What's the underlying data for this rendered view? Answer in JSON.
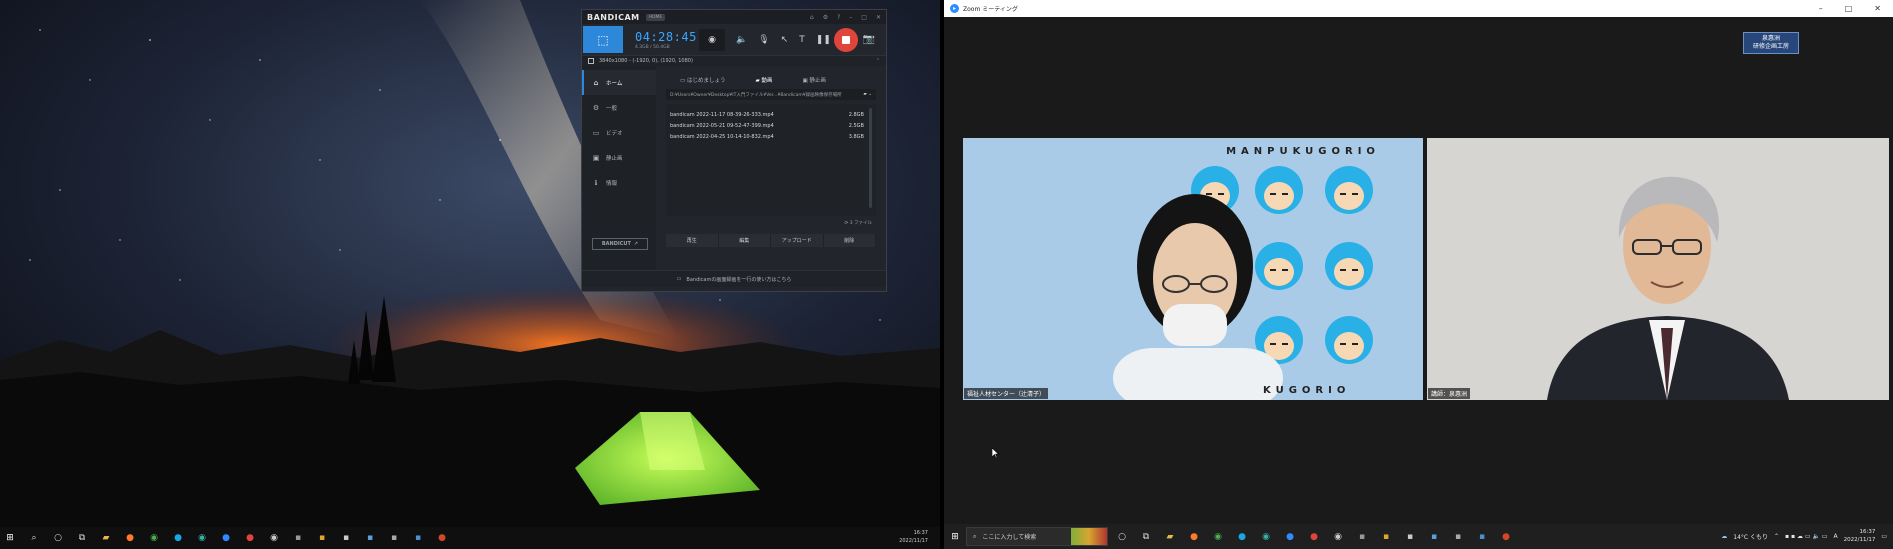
{
  "bandicam": {
    "logo": "BANDICAM",
    "home_tag": "HOME",
    "title_icons": [
      "⌂",
      "⚙",
      "?",
      "–",
      "□",
      "✕"
    ],
    "timer": "04:28:45",
    "size": "4.3GB / 50.4GB",
    "target": "3840x1080 - (-1920, 0), (1920, 1080)",
    "nav": [
      {
        "icon": "⌂",
        "label": "ホーム",
        "active": true
      },
      {
        "icon": "⚙",
        "label": "一般",
        "active": false
      },
      {
        "icon": "▭",
        "label": "ビデオ",
        "active": false
      },
      {
        "icon": "▣",
        "label": "静止画",
        "active": false
      },
      {
        "icon": "ℹ",
        "label": "情報",
        "active": false
      }
    ],
    "bandicut_label": "BANDICUT",
    "tabs": [
      {
        "label": "はじめましょう",
        "active": false
      },
      {
        "label": "動画",
        "active": true
      },
      {
        "label": "静止画",
        "active": false
      }
    ],
    "path": "D:¥Users¥Owner¥Desktop¥IT入門ファイル¥Ver...¥Bandicam¥録画映像保存場所",
    "files": [
      {
        "name": "bandicam 2022-11-17 08-39-26-333.mp4",
        "size": "2.8GB"
      },
      {
        "name": "bandicam 2022-05-21 09-52-47-399.mp4",
        "size": "2.5GB"
      },
      {
        "name": "bandicam 2022-04-25 10-14-10-832.mp4",
        "size": "3.8GB"
      }
    ],
    "file_count": "3 ファイル",
    "actions": [
      "再生",
      "編集",
      "アップロード",
      "削除"
    ],
    "footer": "Bandicamの画面録画を一行の使い方はこちら"
  },
  "left_taskbar": {
    "time": "16:37",
    "date": "2022/11/17"
  },
  "zoom": {
    "window_title": "Zoom ミーティング",
    "tag_line1": "泉惠洲",
    "tag_line2": "研修企画工房",
    "left_tile_label": "福祉人材センター（辻清子）",
    "left_tile_banner": "MANPUKUGORIO",
    "left_tile_banner_partial": "KUGORIO",
    "right_tile_label": "講師：泉惠洲"
  },
  "right_taskbar": {
    "search_placeholder": "ここに入力して検索",
    "weather": "14°C くもり",
    "ime": "A",
    "time": "16:37",
    "date": "2022/11/17"
  },
  "colors": {
    "bandicam_accent": "#2e88d9",
    "bandicam_rec": "#e0453c",
    "zoom_blue": "#2d8cff",
    "tent_green": "#8fe23a"
  }
}
